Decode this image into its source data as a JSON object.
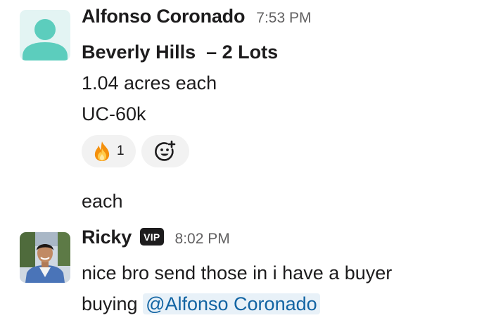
{
  "messages": [
    {
      "sender": "Alfonso Coronado",
      "time": "7:53 PM",
      "avatar_icon": "default-user-icon",
      "lines": {
        "title": "Beverly Hills  – 2 Lots",
        "line1": "1.04 acres each",
        "line2": "UC-60k"
      },
      "reactions": [
        {
          "emoji": "fire",
          "count": "1"
        }
      ],
      "add_reaction_icon": "add-emoji-icon"
    },
    {
      "text": "each"
    },
    {
      "sender": "Ricky",
      "badge": "VIP",
      "time": "8:02 PM",
      "line1": "nice bro send those in i have a buyer",
      "line2_prefix": "buying ",
      "mention": "@Alfonso Coronado"
    }
  ],
  "colors": {
    "timestamp": "#616061",
    "mention_text": "#1264a3",
    "mention_bg": "#e8f1f8",
    "default_avatar_bg": "#e3f4f3",
    "default_avatar_icon": "#5ccdbd",
    "reaction_bg": "#f2f2f2"
  }
}
